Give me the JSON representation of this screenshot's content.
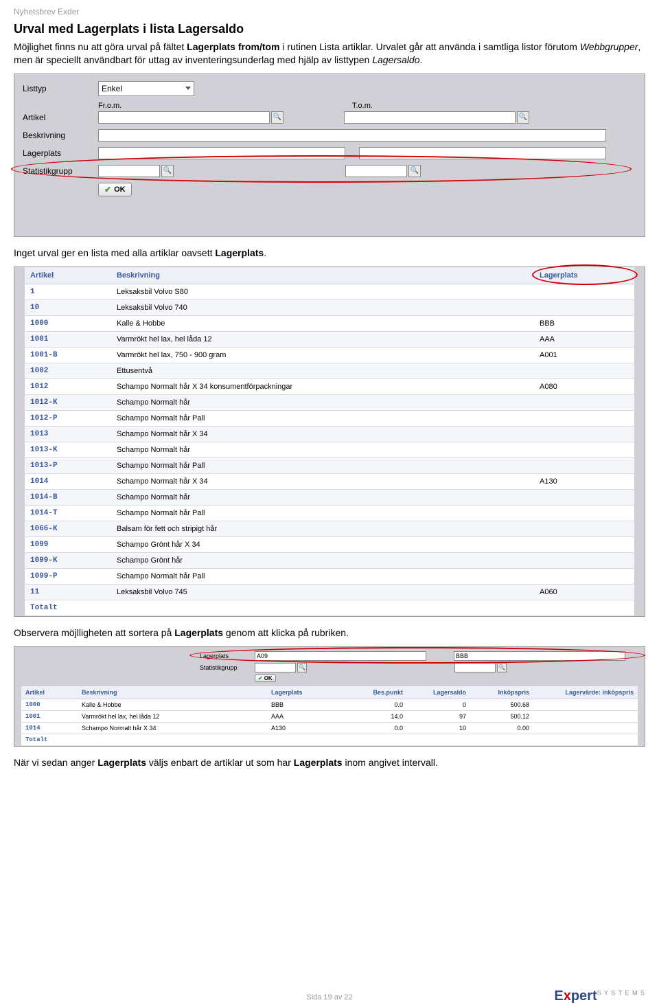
{
  "header": {
    "nyhetsbrev": "Nyhetsbrev Exder"
  },
  "section1": {
    "title": "Urval med Lagerplats i lista Lagersaldo",
    "p1_a": "Möjlighet finns nu att göra urval på fältet ",
    "p1_b": "Lagerplats from/tom",
    "p1_c": " i rutinen ",
    "p1_d": "Lista artiklar",
    "p1_e": ". Urvalet går att använda i samtliga listor förutom ",
    "p1_f": "Webbgrupper",
    "p1_g": ", men är speciellt användbart för uttag av inventeringsunderlag med hjälp av listtypen ",
    "p1_h": "Lagersaldo",
    "p1_i": "."
  },
  "form": {
    "listtyp_label": "Listtyp",
    "listtyp_value": "Enkel",
    "from_label": "Fr.o.m.",
    "to_label": "T.o.m.",
    "artikel_label": "Artikel",
    "beskrivning_label": "Beskrivning",
    "lagerplats_label": "Lagerplats",
    "statistikgrupp_label": "Statistikgrupp",
    "ok_label": "OK"
  },
  "mid_text_a": "Inget urval ger en lista med alla artiklar oavsett ",
  "mid_text_b": "Lagerplats",
  "mid_text_c": ".",
  "table": {
    "headers": {
      "artikel": "Artikel",
      "beskrivning": "Beskrivning",
      "lagerplats": "Lagerplats"
    },
    "rows": [
      {
        "artikel": "1",
        "beskrivning": "Leksaksbil Volvo S80",
        "lagerplats": ""
      },
      {
        "artikel": "10",
        "beskrivning": "Leksaksbil Volvo 740",
        "lagerplats": ""
      },
      {
        "artikel": "1000",
        "beskrivning": "Kalle & Hobbe",
        "lagerplats": "BBB"
      },
      {
        "artikel": "1001",
        "beskrivning": "Varmrökt hel lax, hel låda 12",
        "lagerplats": "AAA"
      },
      {
        "artikel": "1001-B",
        "beskrivning": "Varmrökt hel lax, 750 - 900 gram",
        "lagerplats": "A001"
      },
      {
        "artikel": "1002",
        "beskrivning": "Ettusentvå",
        "lagerplats": ""
      },
      {
        "artikel": "1012",
        "beskrivning": "Schampo Normalt hår X 34 konsumentförpackningar",
        "lagerplats": "A080"
      },
      {
        "artikel": "1012-K",
        "beskrivning": "Schampo Normalt hår",
        "lagerplats": ""
      },
      {
        "artikel": "1012-P",
        "beskrivning": "Schampo Normalt hår Pall",
        "lagerplats": ""
      },
      {
        "artikel": "1013",
        "beskrivning": "Schampo Normalt hår X 34",
        "lagerplats": ""
      },
      {
        "artikel": "1013-K",
        "beskrivning": "Schampo Normalt hår",
        "lagerplats": ""
      },
      {
        "artikel": "1013-P",
        "beskrivning": "Schampo Normalt hår Pall",
        "lagerplats": ""
      },
      {
        "artikel": "1014",
        "beskrivning": "Schampo Normalt hår X 34",
        "lagerplats": "A130"
      },
      {
        "artikel": "1014-B",
        "beskrivning": "Schampo Normalt hår",
        "lagerplats": ""
      },
      {
        "artikel": "1014-T",
        "beskrivning": "Schampo Normalt hår Pall",
        "lagerplats": ""
      },
      {
        "artikel": "1066-K",
        "beskrivning": "Balsam för fett och stripigt hår",
        "lagerplats": ""
      },
      {
        "artikel": "1099",
        "beskrivning": "Schampo Grönt hår X 34",
        "lagerplats": ""
      },
      {
        "artikel": "1099-K",
        "beskrivning": "Schampo Grönt hår",
        "lagerplats": ""
      },
      {
        "artikel": "1099-P",
        "beskrivning": "Schampo Normalt hår Pall",
        "lagerplats": ""
      },
      {
        "artikel": "11",
        "beskrivning": "Leksaksbil Volvo 745",
        "lagerplats": "A060"
      }
    ],
    "totalt": "Totalt"
  },
  "obs_a": "Observera möjlligheten att sortera på ",
  "obs_b": "Lagerplats",
  "obs_c": " genom att klicka på rubriken.",
  "sorted_form": {
    "lagerplats_label": "Lagerplats",
    "lagerplats_from": "A09",
    "lagerplats_to": "BBB",
    "statistik_label": "Statistikgrupp",
    "ok_label": "OK"
  },
  "sorted": {
    "headers": {
      "artikel": "Artikel",
      "beskrivning": "Beskrivning",
      "lagerplats": "Lagerplats",
      "bespunkt": "Bes.punkt",
      "lagersaldo": "Lagersaldo",
      "inkopspris": "Inköpspris",
      "lagervarde": "Lagervärde: inköpspris"
    },
    "rows": [
      {
        "artikel": "1000",
        "beskrivning": "Kalle & Hobbe",
        "lagerplats": "BBB",
        "bespunkt": "0.0",
        "lagersaldo": "0",
        "inkopspris": "500.68",
        "lagervarde": ""
      },
      {
        "artikel": "1001",
        "beskrivning": "Varmrökt hel lax, hel låda 12",
        "lagerplats": "AAA",
        "bespunkt": "14.0",
        "lagersaldo": "97",
        "inkopspris": "500.12",
        "lagervarde": ""
      },
      {
        "artikel": "1014",
        "beskrivning": "Schampo Normalt hår X 34",
        "lagerplats": "A130",
        "bespunkt": "0.0",
        "lagersaldo": "10",
        "inkopspris": "0.00",
        "lagervarde": ""
      }
    ],
    "totalt": "Totalt"
  },
  "final_a": "När vi sedan anger ",
  "final_b": "Lagerplats",
  "final_c": " väljs enbart de artiklar ut som har ",
  "final_d": "Lagerplats",
  "final_e": " inom angivet intervall.",
  "footer": "Sida 19 av 22",
  "logo": {
    "e": "E",
    "x": "x",
    "pert": "pert",
    "sub": "S Y S T E M S"
  }
}
